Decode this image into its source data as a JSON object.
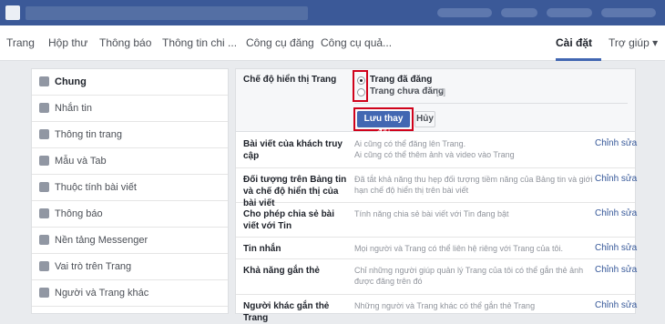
{
  "nav": {
    "tabs": [
      "Trang",
      "Hộp thư",
      "Thông báo",
      "Thông tin chi ...",
      "Công cụ đăng",
      "Công cụ quả...",
      "Cài đặt",
      "Trợ giúp ▾"
    ]
  },
  "sidebar": {
    "items": [
      {
        "label": "Chung",
        "icon": "gear-icon"
      },
      {
        "label": "Nhắn tin",
        "icon": "message-icon"
      },
      {
        "label": "Thông tin trang",
        "icon": "pencil-icon"
      },
      {
        "label": "Mẫu và Tab",
        "icon": "grid-icon"
      },
      {
        "label": "Thuộc tính bài viết",
        "icon": "flag-icon"
      },
      {
        "label": "Thông báo",
        "icon": "globe-icon"
      },
      {
        "label": "Nền tảng Messenger",
        "icon": "chat-icon"
      },
      {
        "label": "Vai trò trên Trang",
        "icon": "person-icon"
      },
      {
        "label": "Người và Trang khác",
        "icon": "people-icon"
      }
    ]
  },
  "editor": {
    "label": "Chế độ hiển thị Trang",
    "option_published": "Trang đã đăng",
    "option_unpublished": "Trang chưa đăng",
    "help_mark": "[?]",
    "save": "Lưu thay đổi",
    "cancel": "Hủy"
  },
  "rows": [
    {
      "label": "Bài viết của khách truy cập",
      "desc": "Ai cũng có thể đăng lên Trang.\nAi cũng có thể thêm ảnh và video vào Trang",
      "edit": "Chỉnh sửa"
    },
    {
      "label": "Đối tượng trên Bảng tin và chế độ hiển thị của bài viết",
      "desc": "Đã tắt khả năng thu hẹp đối tượng tiềm năng của Bảng tin và giới hạn chế độ hiển thị trên bài viết",
      "edit": "Chỉnh sửa"
    },
    {
      "label": "Cho phép chia sẻ bài viết với Tin",
      "desc": "Tính năng chia sẻ bài viết với Tin đang bật",
      "edit": "Chỉnh sửa"
    },
    {
      "label": "Tin nhắn",
      "desc": "Mọi người và Trang có thể liên hệ riêng với Trang của tôi.",
      "edit": "Chỉnh sửa"
    },
    {
      "label": "Khả năng gắn thẻ",
      "desc": "Chỉ những người giúp quản lý Trang của tôi có thể gắn thẻ ảnh được đăng trên đó",
      "edit": "Chỉnh sửa"
    },
    {
      "label": "Người khác gắn thẻ Trang",
      "desc": "Những người và Trang khác có thể gắn thẻ Trang",
      "edit": "Chỉnh sửa"
    }
  ]
}
